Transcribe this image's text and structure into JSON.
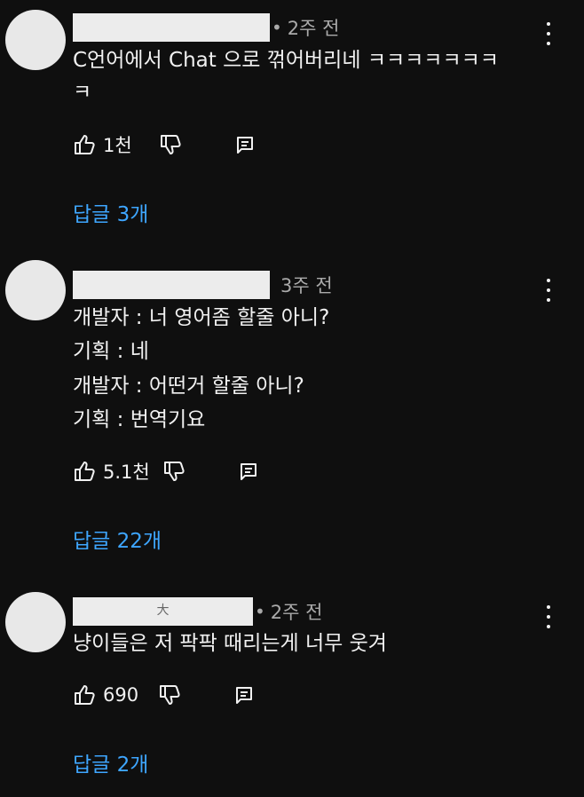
{
  "comments": [
    {
      "redacted_author_mark": "",
      "time_prefix": "•",
      "time": "2주 전",
      "lines": [
        "C언어에서 Chat 으로 꺾어버리네 ㅋㅋㅋㅋㅋㅋㅋ",
        "ㅋ"
      ],
      "likes": "1천",
      "replies": "답글 3개"
    },
    {
      "redacted_author_mark": "",
      "time_prefix": "",
      "time": "3주 전",
      "lines": [
        "개발자 : 너 영어좀 할줄 아니?",
        "기획 : 네",
        "개발자 : 어떤거 할줄 아니?",
        "기획 : 번역기요"
      ],
      "likes": "5.1천",
      "replies": "답글 22개"
    },
    {
      "redacted_author_mark": "大",
      "time_prefix": "•",
      "time": "2주 전",
      "lines": [
        "냥이들은 저 팍팍 때리는게 너무 웃겨"
      ],
      "likes": "690",
      "replies": "답글 2개"
    }
  ],
  "icons": {
    "like": "thumb-up-icon",
    "dislike": "thumb-down-icon",
    "reply": "comment-reply-icon",
    "more": "more-vertical-icon"
  },
  "colors": {
    "background": "#0f0f0f",
    "text": "#f1f1f1",
    "muted": "#aaaaaa",
    "link": "#3ea6ff",
    "avatar": "#e8e8e8"
  }
}
